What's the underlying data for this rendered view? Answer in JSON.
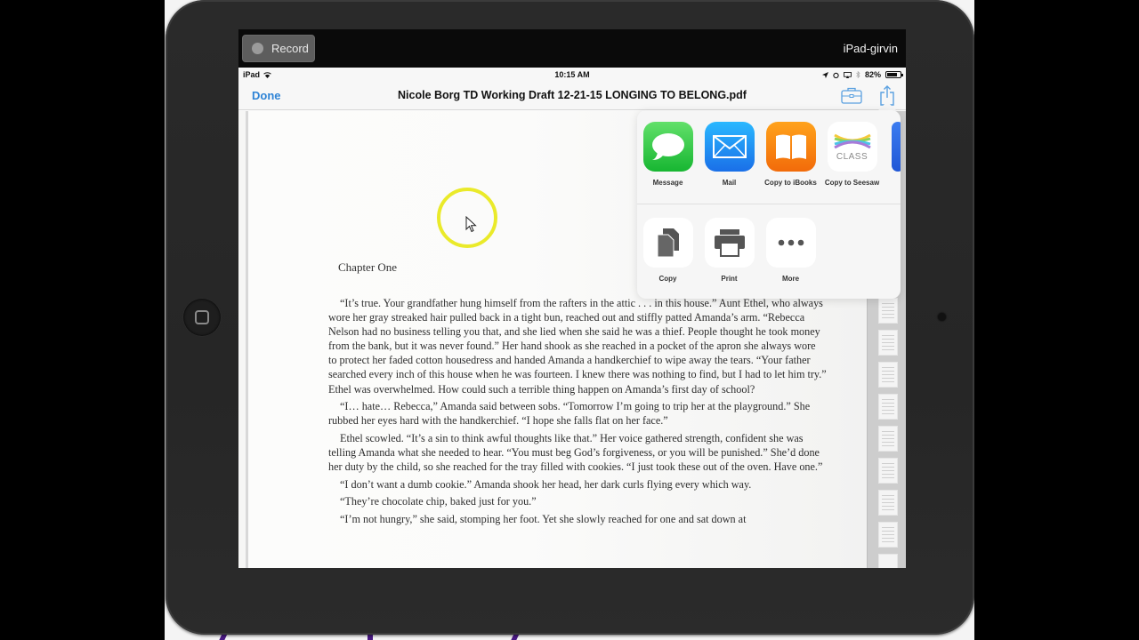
{
  "recorder": {
    "record_label": "Record",
    "device_name": "iPad-girvin"
  },
  "status_bar": {
    "device": "iPad",
    "time": "10:15 AM",
    "battery": "82%",
    "battery_level": 0.82
  },
  "nav_bar": {
    "done_label": "Done",
    "title": "Nicole Borg TD Working Draft 12-21-15 LONGING TO BELONG.pdf",
    "toolbox_icon": "toolbox-icon",
    "share_icon": "share-icon"
  },
  "share_sheet": {
    "apps": [
      {
        "label": "Message",
        "icon": "message-icon"
      },
      {
        "label": "Mail",
        "icon": "mail-icon"
      },
      {
        "label": "Copy to iBooks",
        "icon": "ibooks-icon"
      },
      {
        "label": "Copy to Seesaw",
        "icon": "seesaw-icon",
        "icon_text": "CLASS"
      }
    ],
    "actions": [
      {
        "label": "Copy",
        "icon": "copy-icon"
      },
      {
        "label": "Print",
        "icon": "print-icon"
      },
      {
        "label": "More",
        "icon": "more-icon"
      }
    ]
  },
  "document": {
    "chapter_title": "Chapter One",
    "paragraphs": [
      "“It’s true.  Your grandfather hung himself from the rafters in the attic . . . in this house.”  Aunt Ethel, who always wore her gray streaked hair pulled back in a tight bun, reached out and stiffly patted Amanda’s arm.  “Rebecca Nelson had no business telling you that, and she lied when she said he was a thief.  People thought he took money from the bank, but it was never found.”  Her hand shook as she reached in a pocket of the apron she always wore to protect her faded cotton housedress and handed Amanda a handkerchief to wipe away the tears.  “Your father searched every inch of this house when he was fourteen.  I knew there was nothing to find, but I had to let him try.”  Ethel was overwhelmed.   How could such a terrible thing happen on Amanda’s first day of school?",
      "“I… hate… Rebecca,” Amanda said between sobs.  “Tomorrow I’m going to trip her at the playground.”  She rubbed her eyes hard with the handkerchief.   “I hope she falls flat on her face.”",
      "Ethel scowled.  “It’s a sin to think awful thoughts like that.”  Her voice gathered strength, confident she was telling Amanda what she needed to hear.  “You must beg God’s forgiveness, or you will be punished.”  She’d done her duty by the child, so she reached for the tray filled with cookies.  “I just took these out of the oven.  Have one.”",
      "“I don’t want a dumb cookie.”  Amanda shook her head, her dark curls flying every which way.",
      "“They’re chocolate chip, baked just for you.”",
      "“I’m not hungry,” she said, stomping her foot. Yet she slowly reached for one and sat down at"
    ]
  },
  "colors": {
    "accent": "#2f84d6",
    "cursor_highlight": "#eaea2a",
    "backdrop_text": "#4b1a86"
  }
}
